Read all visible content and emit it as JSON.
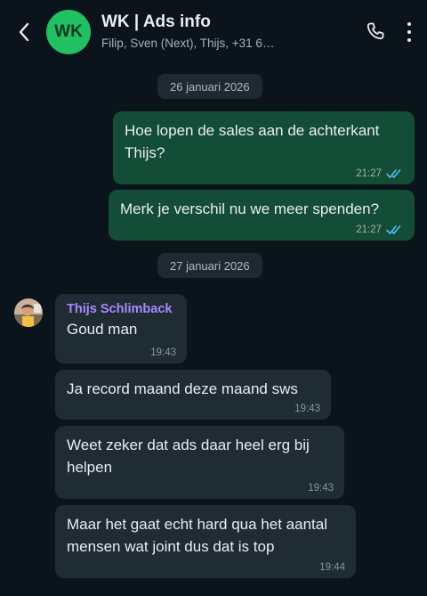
{
  "header": {
    "back_icon": "arrow-left-icon",
    "avatar_initials": "WK",
    "avatar_color": "#21c063",
    "title": "WK | Ads info",
    "subtitle": "Filip, Sven (Next), Thijs, +31 6…",
    "call_icon": "phone-icon",
    "menu_icon": "more-vertical-icon"
  },
  "dates": [
    "26 januari 2026",
    "27 januari 2026"
  ],
  "outgoing": [
    {
      "text": "Hoe lopen de sales aan de achterkant Thijs?",
      "time": "21:27",
      "status_icon": "double-check-icon"
    },
    {
      "text": "Merk je verschil nu we meer spenden?",
      "time": "21:27",
      "status_icon": "double-check-icon"
    }
  ],
  "incoming": {
    "sender": "Thijs Schlimback",
    "sender_color": "#a889ff",
    "messages": [
      {
        "text": "Goud man",
        "time": "19:43"
      },
      {
        "text": "Ja record maand deze maand sws",
        "time": "19:43"
      },
      {
        "text": "Weet zeker dat ads daar heel erg bij helpen",
        "time": "19:43"
      },
      {
        "text": "Maar het gaat echt hard qua het aantal mensen wat joint dus dat is top",
        "time": "19:44"
      }
    ]
  },
  "colors": {
    "background": "#0b141a",
    "outgoing_bubble": "#144d37",
    "incoming_bubble": "#1f2c34",
    "read_ticks": "#53bdeb"
  }
}
